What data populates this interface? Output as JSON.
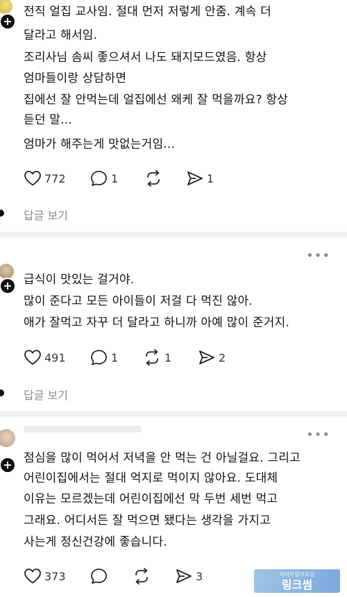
{
  "comments": [
    {
      "lines": [
        "전직 얼집 교사임. 절대 먼저 저렇게 안줌. 계속 더",
        "달라고 해서임.",
        "조리사님 솜씨 좋으셔서 나도 돼지모드였음. 항상",
        "엄마들이랑 상담하면",
        "집에선 잘 안먹는데 얼집에선 왜케 잘 먹을까요? 항상",
        "듣던 말...",
        "엄마가 해주는게 맛없는거임..."
      ],
      "likes": "772",
      "replies": "1",
      "reposts": "",
      "shares": "1",
      "reply_toggle": "답글 보기"
    },
    {
      "lines": [
        "급식이 맛있는 걸거야.",
        "많이 준다고 모든 아이들이 저걸 다 먹진 않아.",
        "애가 잘먹고 자꾸 더 달라고 하니까 아예 많이 준거지."
      ],
      "likes": "491",
      "replies": "1",
      "reposts": "1",
      "shares": "2",
      "reply_toggle": "답글 보기"
    },
    {
      "lines": [
        "점심을 많이 먹어서 저녁을 안 먹는 건 아닐걸요. 그리고",
        "어린이집에서는 절대 억지로 먹이지 않아요. 도대체",
        "이유는 모르겠는데 어린이집에선 막 두번 세번 먹고",
        "그래요. 어디서든 잘 먹으면 됐다는 생각을 가지고",
        "사는게 정신건강에 좋습니다."
      ],
      "likes": "373",
      "replies": "",
      "reposts": "",
      "shares": "3"
    }
  ],
  "more_label": "•••",
  "plus_label": "+",
  "watermark": {
    "sub": "사이트링크모음",
    "main": "링크썸"
  }
}
